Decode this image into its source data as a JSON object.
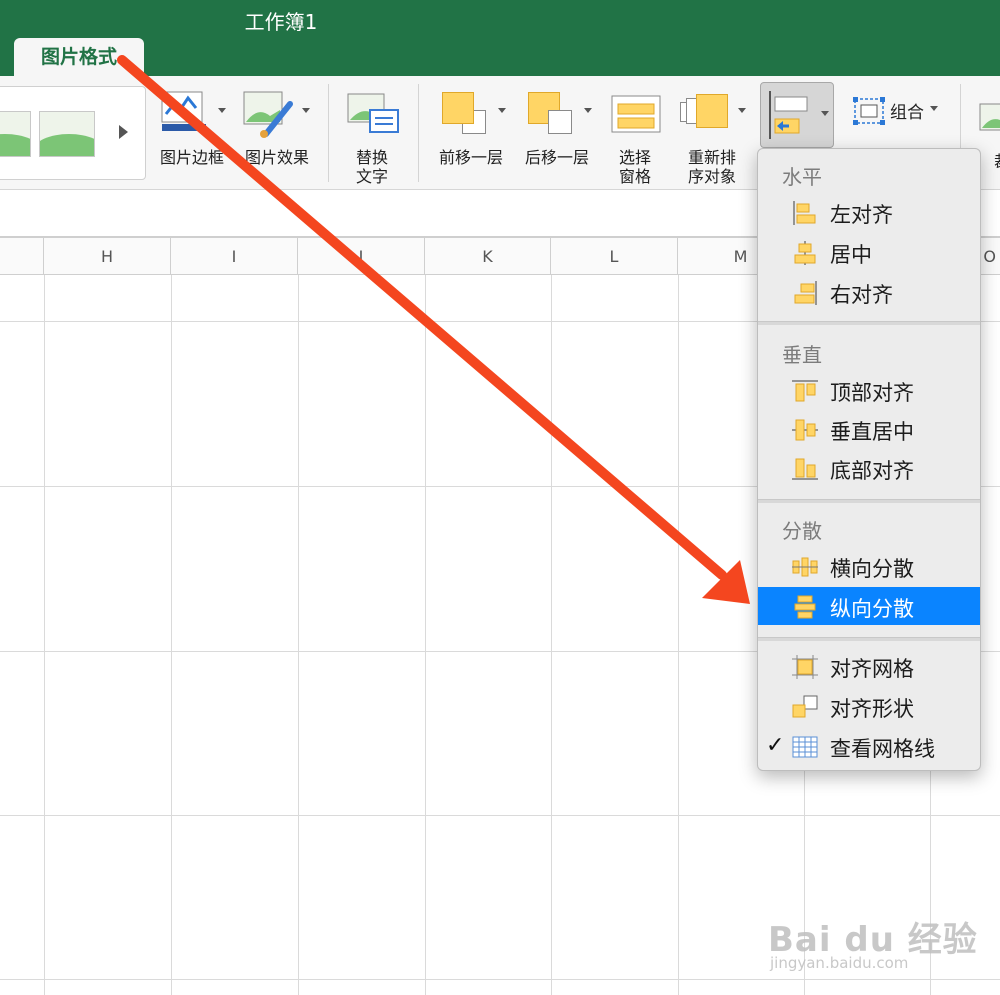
{
  "window": {
    "title": "工作簿1"
  },
  "tabs": {
    "active_label": "图片格式"
  },
  "ribbon": {
    "border_label": "图片边框",
    "effects_label": "图片效果",
    "alt_text_label": [
      "替换",
      "文字"
    ],
    "bring_forward_label": "前移一层",
    "send_backward_label": "后移一层",
    "selection_pane_label": [
      "选择",
      "窗格"
    ],
    "reorder_label": [
      "重新排",
      "序对象"
    ],
    "group_label": "组合",
    "cut_label": "裁"
  },
  "columns": [
    "H",
    "I",
    "J",
    "K",
    "L",
    "M",
    "O"
  ],
  "align_menu": {
    "horizontal_header": "水平",
    "horizontal_items": [
      "左对齐",
      "居中",
      "右对齐"
    ],
    "vertical_header": "垂直",
    "vertical_items": [
      "顶部对齐",
      "垂直居中",
      "底部对齐"
    ],
    "distribute_header": "分散",
    "distribute_items": [
      "横向分散",
      "纵向分散"
    ],
    "selected_item": "纵向分散",
    "other_items": [
      "对齐网格",
      "对齐形状",
      "查看网格线"
    ],
    "checked_item": "查看网格线"
  },
  "colors": {
    "accent_green": "#217346",
    "selection_blue": "#0a84ff",
    "annotation_arrow": "#f4461f"
  },
  "watermark": {
    "brand": "Bai du 经验",
    "url": "jingyan.baidu.com"
  }
}
